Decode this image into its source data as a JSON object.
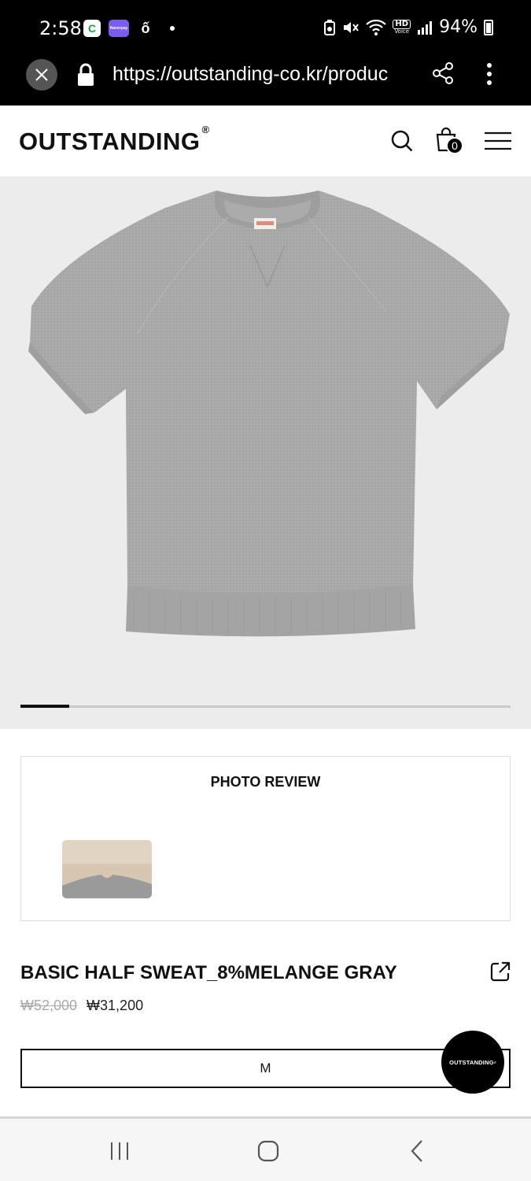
{
  "status_bar": {
    "time": "2:58",
    "battery": "94%",
    "app_icons": [
      "cgv-icon",
      "naverpay-icon",
      "samsung-icon"
    ],
    "app_icon_labels": [
      "C",
      "Naverpay",
      "ố"
    ],
    "hd_label": "HD",
    "voice_label": "Voice"
  },
  "browser": {
    "url": "https://outstanding-co.kr/produc"
  },
  "header": {
    "logo": "OUTSTANDING",
    "logo_mark": "®",
    "cart_count": "0"
  },
  "product_image": {
    "slider_progress": 0.1
  },
  "photo_review": {
    "title": "PHOTO REVIEW"
  },
  "product": {
    "name": "BASIC HALF SWEAT_8%MELANGE GRAY",
    "original_price": "₩52,000",
    "sale_price": "₩31,200",
    "selected_size": "M"
  },
  "fab": {
    "label": "OUTSTANDING"
  },
  "colors": {
    "background": "#ffffff",
    "status_bar": "#000000",
    "image_bg": "#ececec",
    "shirt": "#a8a8a8",
    "old_price": "#aaaaaa"
  }
}
